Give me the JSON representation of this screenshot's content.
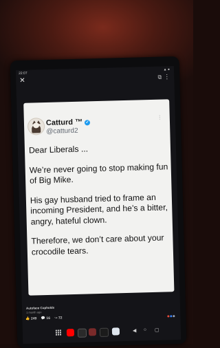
{
  "status": {
    "time": "22:07",
    "right": "▲ ●"
  },
  "topbar": {
    "close_icon": "close-icon",
    "more_icon": "more-vertical-icon",
    "share_icon": "share-icon"
  },
  "tweet": {
    "display_name": "Catturd ™",
    "handle": "@catturd2",
    "lines": [
      "Dear Liberals ...",
      "We’re never going to stop making fun of Big Mike.",
      "His gay husband tried to frame an incoming President, and he’s a bitter, angry, hateful clown.",
      "Therefore, we don’t care about your crocodile tears."
    ]
  },
  "footer": {
    "author": "Autoface Cupholds",
    "time": "1 month ago",
    "likes": "249",
    "comments": "16",
    "shares": "72"
  },
  "colors": {
    "verified": "#1d9bf0",
    "card_bg": "#f2f2f0"
  }
}
